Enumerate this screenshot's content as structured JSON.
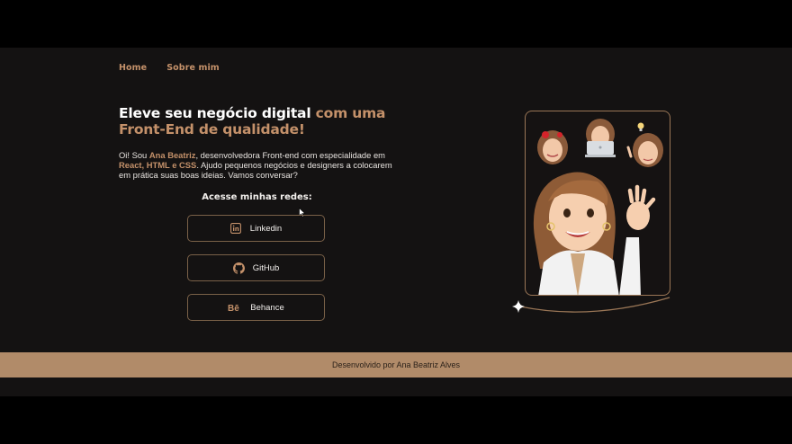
{
  "nav": {
    "items": [
      {
        "label": "Home"
      },
      {
        "label": "Sobre mim"
      }
    ]
  },
  "hero": {
    "headline_white": "Eleve seu negócio digital",
    "headline_accent_1": "com",
    "headline_accent_2": "uma Front-End de qualidade!",
    "intro_1": "Oi! Sou ",
    "intro_name": "Ana Beatriz",
    "intro_2": ", desenvolvedora Front-end com especialidade em ",
    "intro_skills": "React, HTML e CSS",
    "intro_3": ". Ajudo pequenos negócios e designers a colocarem em prática suas boas ideias. Vamos conversar?"
  },
  "social": {
    "title": "Acesse minhas redes:",
    "links": [
      {
        "label": "Linkedin",
        "icon": "linkedin-icon"
      },
      {
        "label": "GitHub",
        "icon": "github-icon"
      },
      {
        "label": "Behance",
        "icon": "behance-icon"
      }
    ]
  },
  "footer": {
    "text": "Desenvolvido por Ana Beatriz Alves"
  },
  "colors": {
    "accent": "#c4916a",
    "background": "#141212",
    "footer_bg": "#b18b69",
    "border": "#7a6148"
  }
}
